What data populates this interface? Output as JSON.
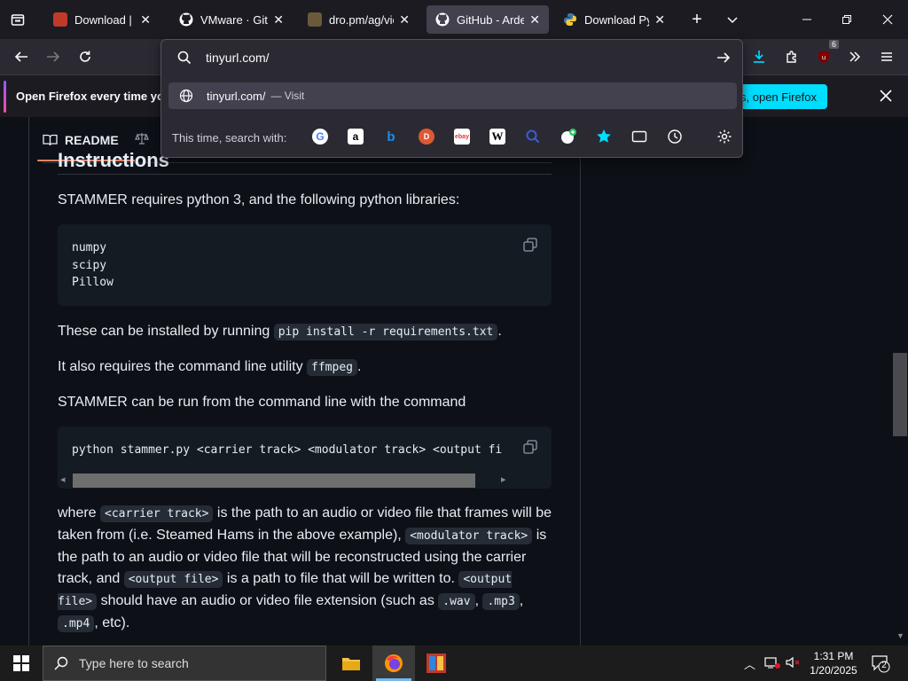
{
  "browser": {
    "tabs": [
      {
        "title": "Download | Min",
        "icon": "minitool-icon",
        "active": false
      },
      {
        "title": "VMware · GitHub",
        "icon": "github-icon",
        "active": false
      },
      {
        "title": "dro.pm/ag/view",
        "icon": "page-icon",
        "active": false
      },
      {
        "title": "GitHub - Arden",
        "icon": "github-icon",
        "active": true
      },
      {
        "title": "Download Pyth",
        "icon": "python-icon",
        "active": false
      }
    ],
    "new_tab_symbol": "+",
    "url": "tinyurl.com/",
    "suggestion": {
      "text": "tinyurl.com/",
      "action": "— Visit"
    },
    "search_with_label": "This time, search with:",
    "extension_badge": "6"
  },
  "notification": {
    "text": "Open Firefox every time you",
    "button": "es, open Firefox"
  },
  "readme": {
    "tab_label": "README",
    "heading_partial": "Instructions",
    "p1": "STAMMER requires python 3, and the following python libraries:",
    "libs": "numpy\nscipy\nPillow",
    "p2_before": "These can be installed by running ",
    "p2_code": "pip install -r requirements.txt",
    "p2_after": ".",
    "p3_before": "It also requires the command line utility ",
    "p3_code": "ffmpeg",
    "p3_after": ".",
    "p4": "STAMMER can be run from the command line with the command",
    "command": "python stammer.py <carrier track> <modulator track> <output fi",
    "p5": {
      "t1": "where ",
      "c1": "<carrier track>",
      "t2": " is the path to an audio or video file that frames will be taken from (i.e. Steamed Hams in the above example), ",
      "c2": "<modulator track>",
      "t3": " is the path to an audio or video file that will be reconstructed using the carrier track, and ",
      "c3": "<output file>",
      "t4": " is a path to file that will be written to. ",
      "c4": "<output file>",
      "t5": " should have an audio or video file extension (such as ",
      "c5": ".wav",
      "t6": ", ",
      "c6": ".mp3",
      "t7": ", ",
      "c7": ".mp4",
      "t8": ", etc)."
    }
  },
  "taskbar": {
    "search_placeholder": "Type here to search",
    "time": "1:31 PM",
    "date": "1/20/2025",
    "notifications": "2"
  }
}
